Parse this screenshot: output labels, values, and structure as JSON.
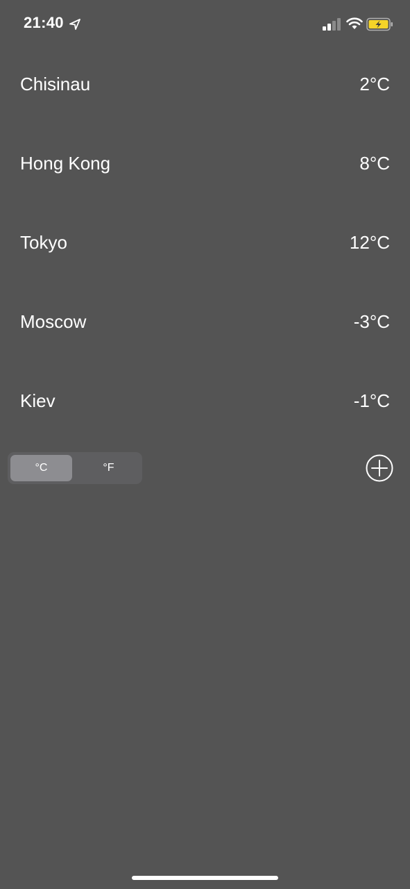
{
  "status_bar": {
    "time": "21:40",
    "icons": [
      "location-arrow-icon",
      "cellular-signal-icon",
      "wifi-icon",
      "battery-charging-icon"
    ],
    "battery_color": "#f5d428"
  },
  "cities": [
    {
      "name": "Chisinau",
      "temp": "2°C"
    },
    {
      "name": "Hong Kong",
      "temp": "8°C"
    },
    {
      "name": "Tokyo",
      "temp": "12°C"
    },
    {
      "name": "Moscow",
      "temp": "-3°C"
    },
    {
      "name": "Kiev",
      "temp": "-1°C"
    }
  ],
  "unit_toggle": {
    "options": [
      "°C",
      "°F"
    ],
    "selected": "°C"
  },
  "add_button": {
    "icon": "plus-circle-icon"
  },
  "colors": {
    "background": "#545454",
    "toggle_track": "#5e5e60",
    "toggle_selected": "#8d8d91"
  }
}
